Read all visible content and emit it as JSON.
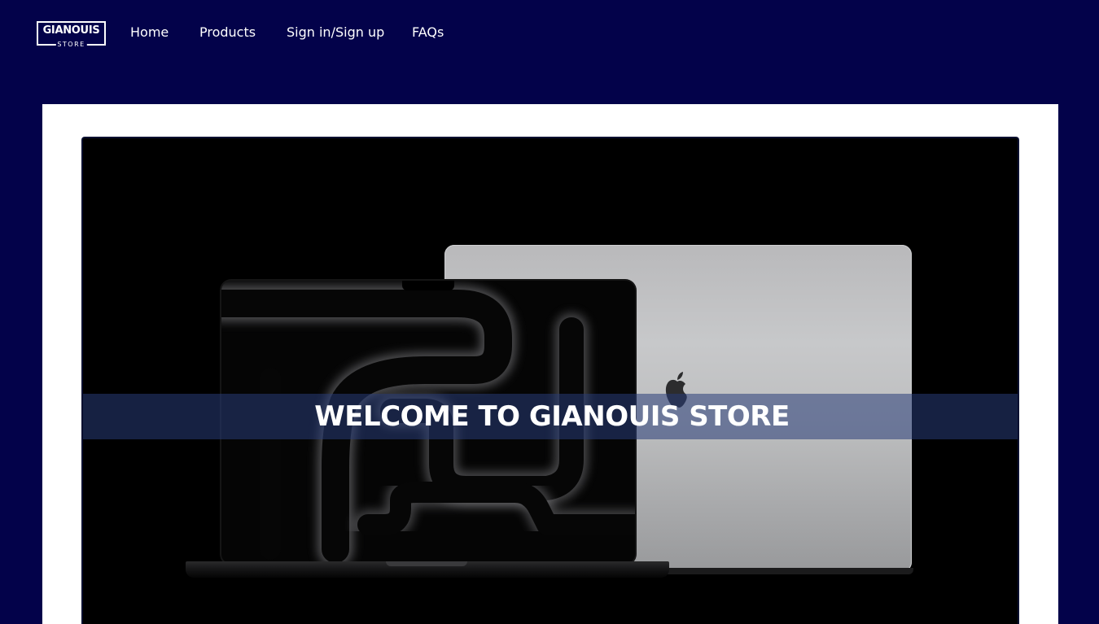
{
  "header": {
    "logo": {
      "main": "GIANOUIS",
      "sub": "STORE"
    },
    "nav": {
      "home": "Home",
      "products": "Products",
      "signin": "Sign in/Sign up",
      "faqs": "FAQs"
    }
  },
  "hero": {
    "banner_text": "WELCOME TO GIANOUIS STORE",
    "image_icons": [
      "laptop-illustration",
      "apple-logo-icon"
    ]
  },
  "colors": {
    "page_background": "#03024a",
    "panel_background": "#ffffff",
    "hero_background": "#000000",
    "banner_overlay": "rgba(40, 60, 120, 0.55)",
    "text": "#ffffff"
  }
}
